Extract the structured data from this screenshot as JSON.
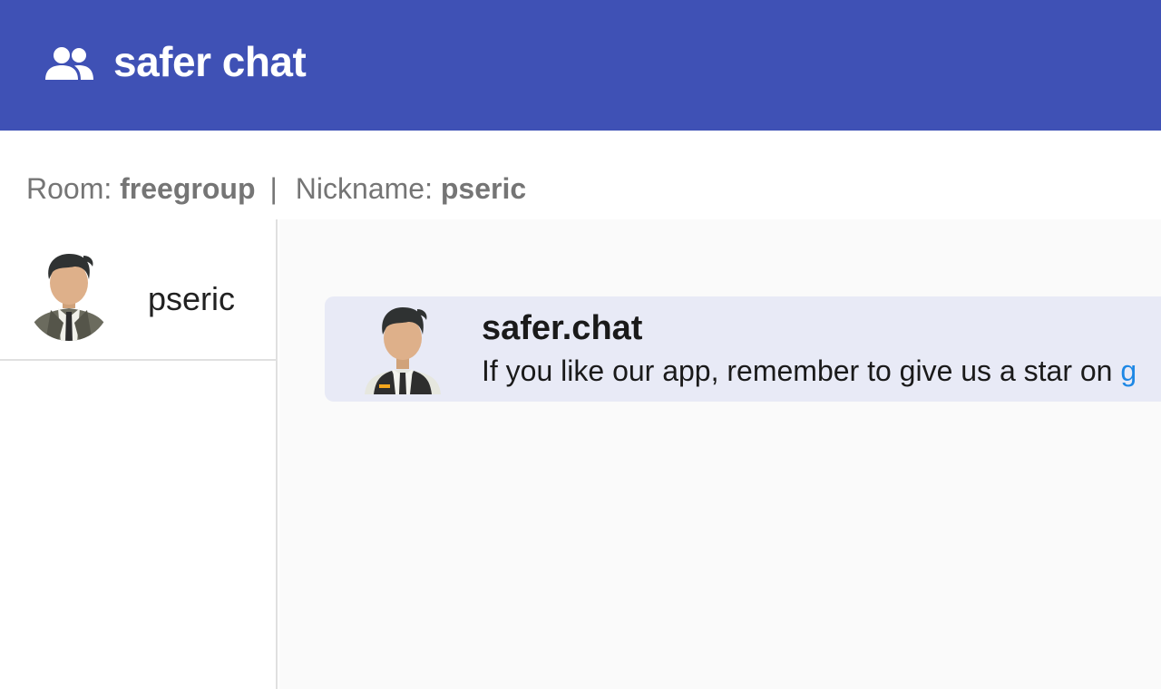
{
  "header": {
    "title": "safer chat",
    "icon": "group-icon",
    "background": "#3f51b5"
  },
  "info": {
    "room_label": "Room:",
    "room_value": "freegroup",
    "separator": "|",
    "nickname_label": "Nickname:",
    "nickname_value": "pseric"
  },
  "sidebar": {
    "users": [
      {
        "name": "pseric",
        "avatar": "businessman-avatar-icon"
      }
    ]
  },
  "chat": {
    "messages": [
      {
        "sender": "safer.chat",
        "avatar": "waiter-avatar-icon",
        "text": "If you like our app, remember to give us a star on ",
        "link_text": "g",
        "background": "#e8eaf6"
      }
    ]
  }
}
